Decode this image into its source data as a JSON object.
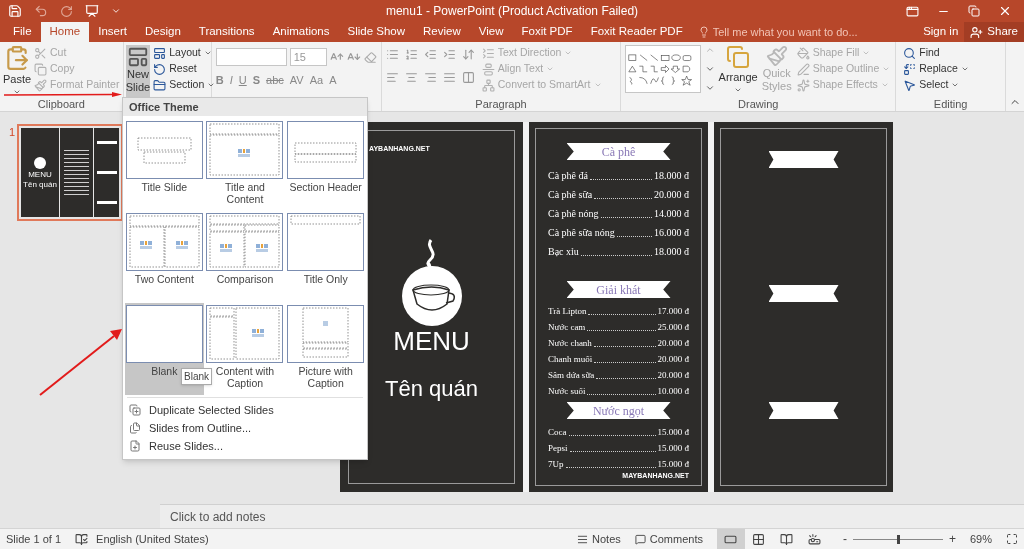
{
  "window": {
    "title": "menu1 - PowerPoint (Product Activation Failed)"
  },
  "tabs": [
    {
      "label": "File",
      "selected": false
    },
    {
      "label": "Home",
      "selected": true
    },
    {
      "label": "Insert",
      "selected": false
    },
    {
      "label": "Design",
      "selected": false
    },
    {
      "label": "Transitions",
      "selected": false
    },
    {
      "label": "Animations",
      "selected": false
    },
    {
      "label": "Slide Show",
      "selected": false
    },
    {
      "label": "Review",
      "selected": false
    },
    {
      "label": "View",
      "selected": false
    },
    {
      "label": "Foxit PDF",
      "selected": false
    },
    {
      "label": "Foxit Reader PDF",
      "selected": false
    }
  ],
  "tell_me": {
    "placeholder": "Tell me what you want to do..."
  },
  "account": {
    "sign_in": "Sign in",
    "share": "Share"
  },
  "ribbon": {
    "clipboard": {
      "label": "Clipboard",
      "paste": "Paste",
      "commands": [
        {
          "label": "Cut",
          "disabled": true
        },
        {
          "label": "Copy",
          "disabled": true
        },
        {
          "label": "Format Painter",
          "disabled": true
        }
      ]
    },
    "slides": {
      "new_slide": {
        "label": "New Slide",
        "selected": true
      },
      "commands": [
        {
          "label": "Layout"
        },
        {
          "label": "Reset"
        },
        {
          "label": "Section"
        }
      ]
    },
    "font": {
      "size": "15",
      "formats": [
        "B",
        "I",
        "U",
        "S",
        "abc",
        "AV",
        "Aa",
        "A"
      ]
    },
    "paragraph": {
      "label": "Paragraph",
      "commands": [
        {
          "label": "Text Direction",
          "disabled": true
        },
        {
          "label": "Align Text",
          "disabled": true
        },
        {
          "label": "Convert to SmartArt",
          "disabled": true
        }
      ]
    },
    "drawing": {
      "label": "Drawing",
      "arrange": "Arrange",
      "quick_styles": {
        "label": "Quick Styles",
        "disabled": true
      },
      "commands": [
        {
          "label": "Shape Fill",
          "disabled": true
        },
        {
          "label": "Shape Outline",
          "disabled": true
        },
        {
          "label": "Shape Effects",
          "disabled": true
        }
      ]
    },
    "editing": {
      "label": "Editing",
      "commands": [
        {
          "label": "Find"
        },
        {
          "label": "Replace"
        },
        {
          "label": "Select"
        }
      ]
    }
  },
  "slide_pane": {
    "number": "1",
    "selected": true,
    "thumbnail": {
      "title": "MENU",
      "subtitle": "Tên quán"
    }
  },
  "slide": {
    "cover": {
      "logo": "AYBANHANG.NET",
      "title": "MENU",
      "subtitle": "Tên quán"
    },
    "menu": {
      "logo": "MAYBANHANG.NET",
      "sections": [
        {
          "title": "Cà phê",
          "items": [
            {
              "name": "Cà phê đá",
              "price": "18.000 đ"
            },
            {
              "name": "Cà phê sữa",
              "price": "20.000 đ"
            },
            {
              "name": "Cà phê nóng",
              "price": "14.000 đ"
            },
            {
              "name": "Cà phê sữa nóng",
              "price": "16.000 đ"
            },
            {
              "name": "Bạc xỉu",
              "price": "18.000 đ"
            }
          ]
        },
        {
          "title": "Giải khát",
          "items": [
            {
              "name": "Trà Lipton",
              "price": "17.000 đ"
            },
            {
              "name": "Nước cam",
              "price": "25.000 đ"
            },
            {
              "name": "Nước chanh",
              "price": "20.000 đ"
            },
            {
              "name": "Chanh muối",
              "price": "20.000 đ"
            },
            {
              "name": "Sâm dứa sữa",
              "price": "20.000 đ"
            },
            {
              "name": "Nước suối",
              "price": "10.000 đ"
            }
          ]
        },
        {
          "title": "Nước ngọt",
          "items": [
            {
              "name": "Coca",
              "price": "15.000 đ"
            },
            {
              "name": "Pepsi",
              "price": "15.000 đ"
            },
            {
              "name": "7Up",
              "price": "15.000 đ"
            }
          ]
        }
      ]
    }
  },
  "notes": {
    "placeholder": "Click to add notes"
  },
  "new_slide_menu": {
    "header": "Office Theme",
    "tooltip": "Blank",
    "layouts": [
      {
        "kind": "title",
        "label": "Title Slide",
        "selected": false
      },
      {
        "kind": "title_content",
        "label": "Title and Content",
        "selected": false
      },
      {
        "kind": "section",
        "label": "Section Header",
        "selected": false
      },
      {
        "kind": "two_content",
        "label": "Two Content",
        "selected": false
      },
      {
        "kind": "comparison",
        "label": "Comparison",
        "selected": false
      },
      {
        "kind": "title_only",
        "label": "Title Only",
        "selected": false
      },
      {
        "kind": "blank",
        "label": "Blank",
        "selected": true
      },
      {
        "kind": "content_caption",
        "label": "Content with Caption",
        "selected": false
      },
      {
        "kind": "picture_caption",
        "label": "Picture with Caption",
        "selected": false
      }
    ],
    "commands": [
      {
        "label": "Duplicate Selected Slides"
      },
      {
        "label": "Slides from Outline..."
      },
      {
        "label": "Reuse Slides..."
      }
    ]
  },
  "status_bar": {
    "slide": "Slide 1 of 1",
    "language": "English (United States)",
    "notes": "Notes",
    "comments": "Comments",
    "views": [
      {
        "selected": true
      },
      {
        "selected": false
      },
      {
        "selected": false
      },
      {
        "selected": false
      }
    ],
    "zoom_out": "-",
    "zoom_in": "+",
    "zoom": {
      "level": 0.5,
      "reading": "69%"
    }
  }
}
